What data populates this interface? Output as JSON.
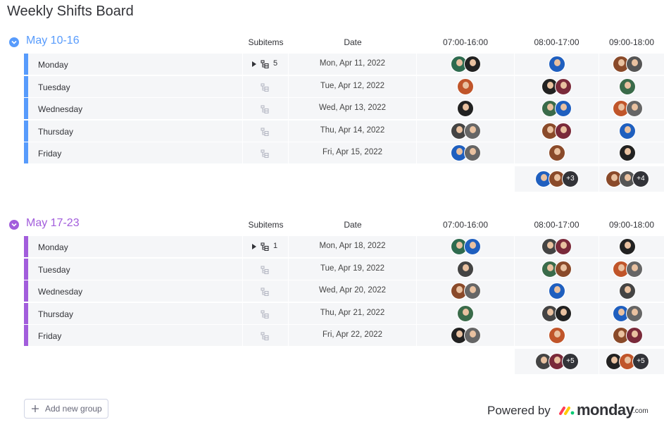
{
  "board": {
    "title": "Weekly Shifts Board"
  },
  "columns": {
    "subitems": "Subitems",
    "date": "Date",
    "shift1": "07:00-16:00",
    "shift2": "08:00-17:00",
    "shift3": "09:00-18:00"
  },
  "groups": [
    {
      "name": "May 10-16",
      "color": "#579bfc",
      "rows": [
        {
          "name": "Monday",
          "subitems": "5",
          "date": "Mon, Apr 11, 2022",
          "s1": [
            "#2e6b4f",
            "#222222"
          ],
          "s2": [
            "#1f5fbf"
          ],
          "s3": [
            "#8a4a2a",
            "#555555"
          ]
        },
        {
          "name": "Tuesday",
          "subitems": "",
          "date": "Tue, Apr 12, 2022",
          "s1": [
            "#c0552a"
          ],
          "s2": [
            "#222222",
            "#7a2a3a"
          ],
          "s3": [
            "#3a6b4a"
          ]
        },
        {
          "name": "Wednesday",
          "subitems": "",
          "date": "Wed, Apr 13, 2022",
          "s1": [
            "#222222"
          ],
          "s2": [
            "#3a6b4a",
            "#1f5fbf"
          ],
          "s3": [
            "#c0552a",
            "#666666"
          ]
        },
        {
          "name": "Thursday",
          "subitems": "",
          "date": "Thu, Apr 14, 2022",
          "s1": [
            "#444444",
            "#666666"
          ],
          "s2": [
            "#8a4a2a",
            "#7a2a3a"
          ],
          "s3": [
            "#1f5fbf"
          ]
        },
        {
          "name": "Friday",
          "subitems": "",
          "date": "Fri, Apr 15, 2022",
          "s1": [
            "#1f5fbf",
            "#666666"
          ],
          "s2": [
            "#8a4a2a"
          ],
          "s3": [
            "#222222"
          ]
        }
      ],
      "summary": {
        "s2": [
          "#1f5fbf",
          "#8a4a2a"
        ],
        "s2_more": "+3",
        "s3": [
          "#8a4a2a",
          "#555555"
        ],
        "s3_more": "+4"
      }
    },
    {
      "name": "May 17-23",
      "color": "#a25ddc",
      "rows": [
        {
          "name": "Monday",
          "subitems": "1",
          "date": "Mon, Apr 18, 2022",
          "s1": [
            "#2e6b4f",
            "#1f5fbf"
          ],
          "s2": [
            "#444444",
            "#7a2a3a"
          ],
          "s3": [
            "#222222"
          ]
        },
        {
          "name": "Tuesday",
          "subitems": "",
          "date": "Tue, Apr 19, 2022",
          "s1": [
            "#444444"
          ],
          "s2": [
            "#3a6b4a",
            "#8a4a2a"
          ],
          "s3": [
            "#c0552a",
            "#666666"
          ]
        },
        {
          "name": "Wednesday",
          "subitems": "",
          "date": "Wed, Apr 20, 2022",
          "s1": [
            "#8a4a2a",
            "#666666"
          ],
          "s2": [
            "#1f5fbf"
          ],
          "s3": [
            "#444444"
          ]
        },
        {
          "name": "Thursday",
          "subitems": "",
          "date": "Thu, Apr 21, 2022",
          "s1": [
            "#3a6b4a"
          ],
          "s2": [
            "#444444",
            "#222222"
          ],
          "s3": [
            "#1f5fbf",
            "#666666"
          ]
        },
        {
          "name": "Friday",
          "subitems": "",
          "date": "Fri, Apr 22, 2022",
          "s1": [
            "#222222",
            "#666666"
          ],
          "s2": [
            "#c0552a"
          ],
          "s3": [
            "#8a4a2a",
            "#7a2a3a"
          ]
        }
      ],
      "summary": {
        "s2": [
          "#444444",
          "#7a2a3a"
        ],
        "s2_more": "+5",
        "s3": [
          "#222222",
          "#c0552a"
        ],
        "s3_more": "+5"
      }
    }
  ],
  "footer": {
    "add_group_label": "Add new group",
    "powered_by": "Powered by",
    "logo_text": "monday",
    "logo_tld": ".com"
  },
  "icons": {
    "collapse": "chevron-down-circle-icon",
    "subitems": "subitems-tree-icon",
    "expand": "caret-right-icon",
    "add": "plus-icon"
  }
}
